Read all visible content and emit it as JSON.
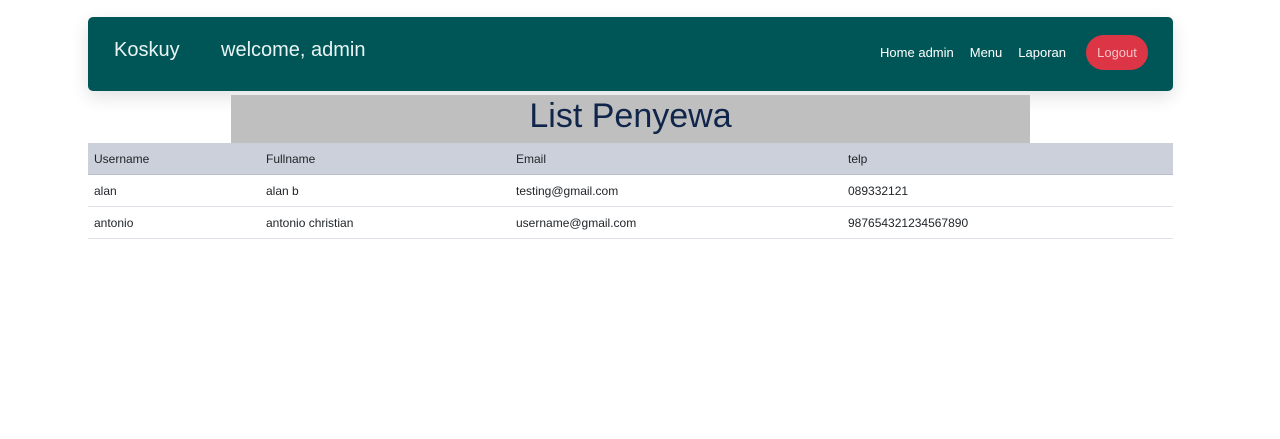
{
  "navbar": {
    "brand": "Koskuy",
    "welcome": "welcome, admin",
    "links": [
      "Home admin",
      "Menu",
      "Laporan"
    ],
    "logout_label": "Logout",
    "background_color": "#005656",
    "logout_color": "#dc3545"
  },
  "page": {
    "title": "List Penyewa"
  },
  "table": {
    "headers": [
      "Username",
      "Fullname",
      "Email",
      "telp"
    ],
    "rows": [
      [
        "alan",
        "alan b",
        "testing@gmail.com",
        "089332121"
      ],
      [
        "antonio",
        "antonio christian",
        "username@gmail.com",
        "987654321234567890"
      ]
    ]
  }
}
